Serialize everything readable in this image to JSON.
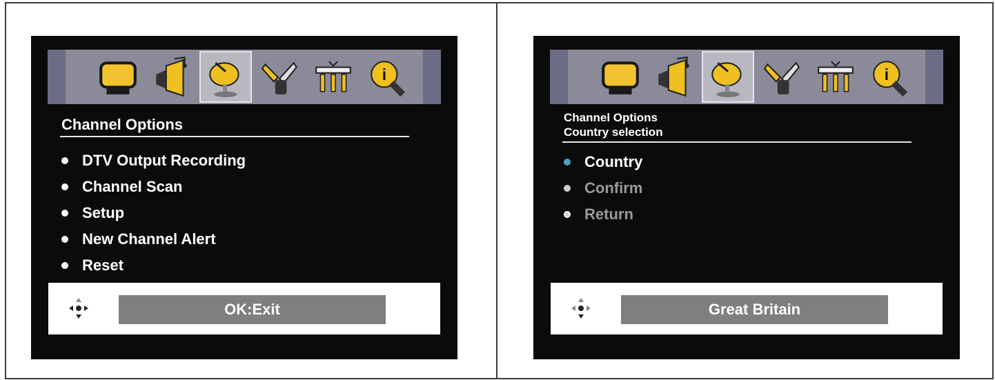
{
  "left_screen": {
    "header": "Channel Options",
    "menu_items": [
      "DTV Output Recording",
      "Channel Scan",
      "Setup",
      "New Channel Alert",
      "Reset"
    ],
    "footer_label": "OK:Exit",
    "selected_icon": "satellite-dish-icon"
  },
  "right_screen": {
    "header_line1": "Channel Options",
    "header_line2": "Country selection",
    "menu_items": [
      "Country",
      "Confirm",
      "Return"
    ],
    "footer_label": "Great Britain",
    "selected_icon": "satellite-dish-icon"
  },
  "icons": [
    "tv-picture-icon",
    "speaker-sound-icon",
    "satellite-dish-icon",
    "wrench-tools-icon",
    "connections-icon",
    "info-bulb-icon"
  ],
  "colors": {
    "screen_bg": "#0b0b0b",
    "icon_bar": "#8a8a98",
    "active_bullet": "#4aa3c8",
    "dim_text": "#9a9a9a",
    "footer_box": "#7f7f7f"
  }
}
